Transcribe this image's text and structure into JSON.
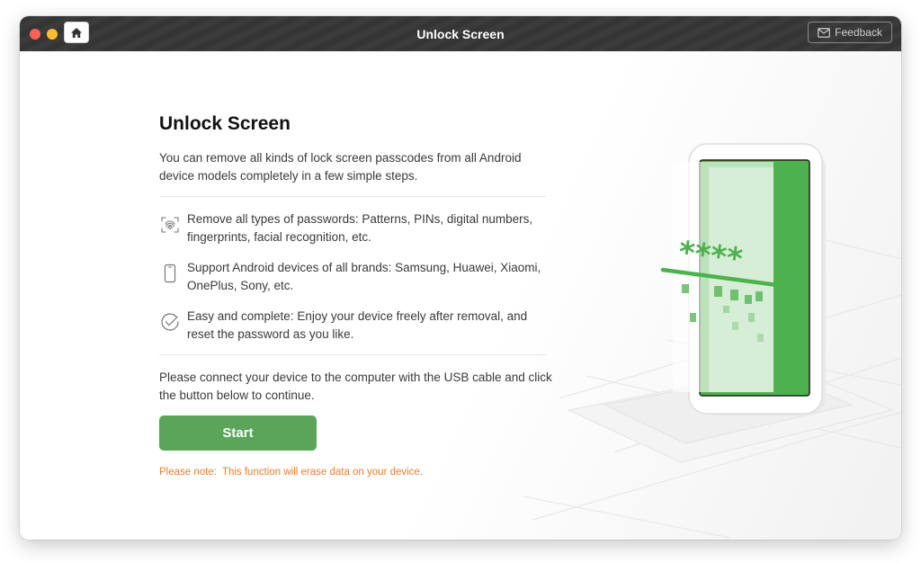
{
  "window": {
    "title": "Unlock Screen",
    "feedback_label": "Feedback"
  },
  "main": {
    "heading": "Unlock Screen",
    "intro": "You can remove all kinds of lock screen passcodes from all Android device models completely in a few simple steps.",
    "features": [
      {
        "icon": "fingerprint-icon",
        "text": "Remove all types of passwords: Patterns, PINs, digital numbers, fingerprints, facial recognition, etc."
      },
      {
        "icon": "phone-icon",
        "text": "Support Android devices of all brands: Samsung, Huawei, Xiaomi, OnePlus, Sony, etc."
      },
      {
        "icon": "check-circle-icon",
        "text": "Easy and complete: Enjoy your device freely after removal, and reset the password as you like."
      }
    ],
    "instruction": "Please connect your device to the computer with the USB cable and click the button below to continue.",
    "start_label": "Start",
    "note_label": "Please note:",
    "note_text": "This function will erase data on your device."
  },
  "illustration": {
    "passcode": "****"
  },
  "colors": {
    "accent_green": "#5aa55a",
    "note_orange": "#ef7d2c",
    "titlebar": "#383838"
  }
}
